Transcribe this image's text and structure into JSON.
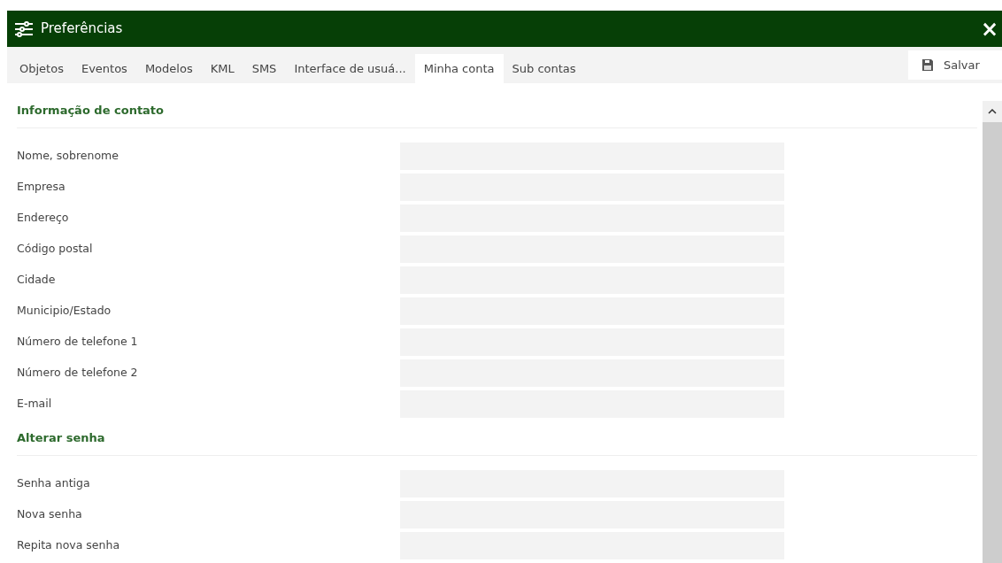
{
  "window": {
    "title": "Preferências",
    "close": "×"
  },
  "tabs": [
    {
      "label": "Objetos",
      "selected": false
    },
    {
      "label": "Eventos",
      "selected": false
    },
    {
      "label": "Modelos",
      "selected": false
    },
    {
      "label": "KML",
      "selected": false
    },
    {
      "label": "SMS",
      "selected": false
    },
    {
      "label": "Interface de usuá...",
      "selected": false
    },
    {
      "label": "Minha conta",
      "selected": true
    },
    {
      "label": "Sub contas",
      "selected": false
    }
  ],
  "save_button": "Salvar",
  "sections": [
    {
      "title": "Informação de contato",
      "fields": [
        {
          "label": "Nome, sobrenome"
        },
        {
          "label": "Empresa"
        },
        {
          "label": "Endereço"
        },
        {
          "label": "Código postal"
        },
        {
          "label": "Cidade"
        },
        {
          "label": "Municipio/Estado"
        },
        {
          "label": "Número de telefone 1"
        },
        {
          "label": "Número de telefone 2"
        },
        {
          "label": "E-mail"
        }
      ]
    },
    {
      "title": "Alterar senha",
      "fields": [
        {
          "label": "Senha antiga"
        },
        {
          "label": "Nova senha"
        },
        {
          "label": "Repita nova senha"
        }
      ]
    }
  ]
}
